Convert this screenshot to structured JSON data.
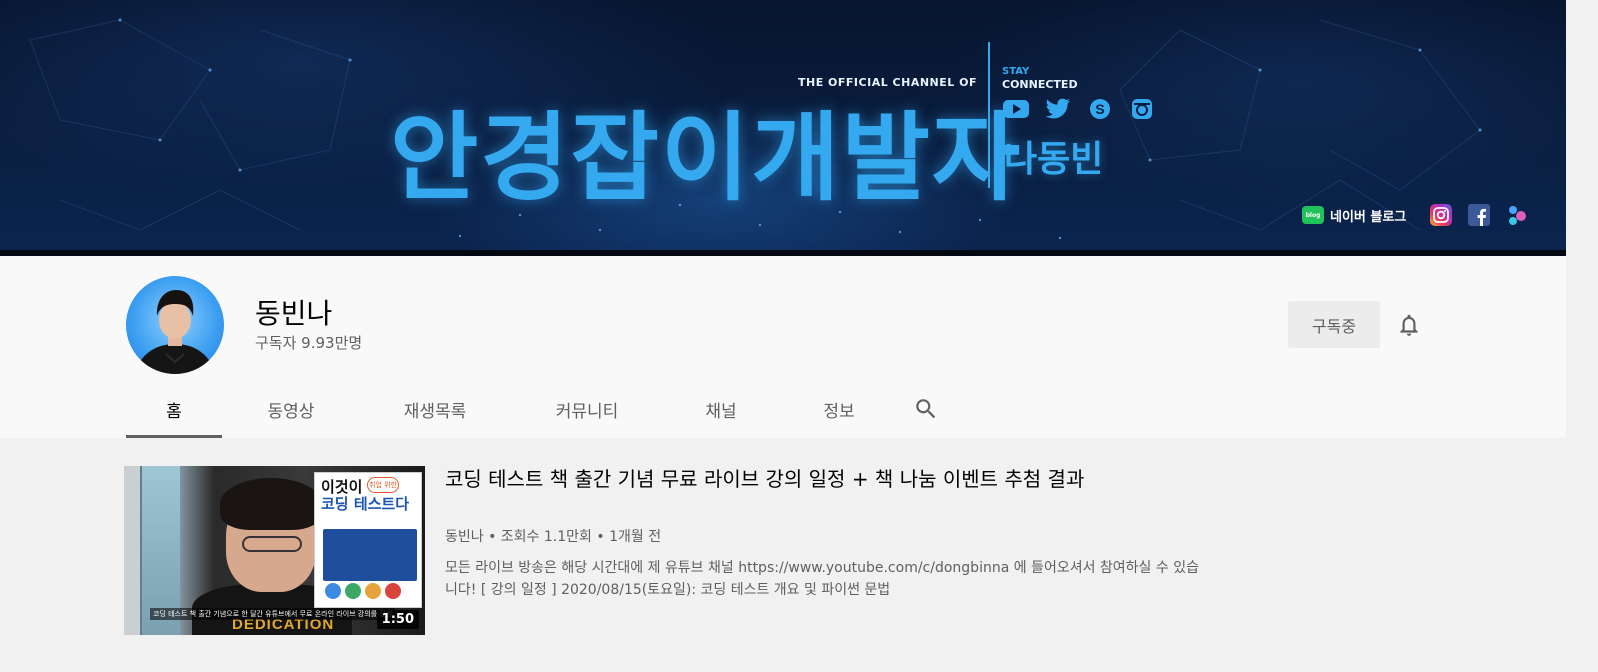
{
  "banner": {
    "official_channel": "THE OFFICIAL CHANNEL OF",
    "title": "안경잡이개발자",
    "stay": "STAY",
    "connected": "CONNECTED",
    "name": "나동빈",
    "social_icons": [
      "youtube-icon",
      "twitter-icon",
      "skype-icon",
      "instagram-icon"
    ],
    "links": {
      "blog_badge": "blog",
      "blog_label": "네이버 블로그",
      "icons": [
        "instagram-icon",
        "facebook-icon",
        "app-icon"
      ]
    },
    "colors": {
      "accent": "#35a9f0",
      "background": "#0a1e3f"
    }
  },
  "channel": {
    "name": "동빈나",
    "subscribers": "구독자 9.93만명",
    "subscribe_button": "구독중",
    "bell_icon": "bell-icon"
  },
  "tabs": [
    {
      "label": "홈",
      "active": true
    },
    {
      "label": "동영상"
    },
    {
      "label": "재생목록"
    },
    {
      "label": "커뮤니티"
    },
    {
      "label": "채널"
    },
    {
      "label": "정보"
    }
  ],
  "search_icon": "search-icon",
  "featured_video": {
    "title": "코딩 테스트 책 출간 기념 무료 라이브 강의 일정 + 책 나눔 이벤트 추첨 결과",
    "meta": "동빈나 • 조회수 1.1만회 • 1개월 전",
    "description": "모든 라이브 방송은 해당 시간대에 제 유튜브 채널 https://www.youtube.com/c/dongbinna 에 들어오셔서 참여하실 수 있습니다! [ 강의 일정 ] 2020/08/15(토요일): 코딩 테스트 개요 및 파이썬 문법",
    "duration": "1:50",
    "thumbnail": {
      "book_title_1": "이것이",
      "book_title_2": "코딩 테스트다",
      "book_badge": "취업 위한",
      "shirt_text": "DEDICATION",
      "caption": "코딩 테스트 책 출간 기념으로 한 달간 유튜브에서 무료 온라인 라이브 강의를 진행"
    }
  }
}
